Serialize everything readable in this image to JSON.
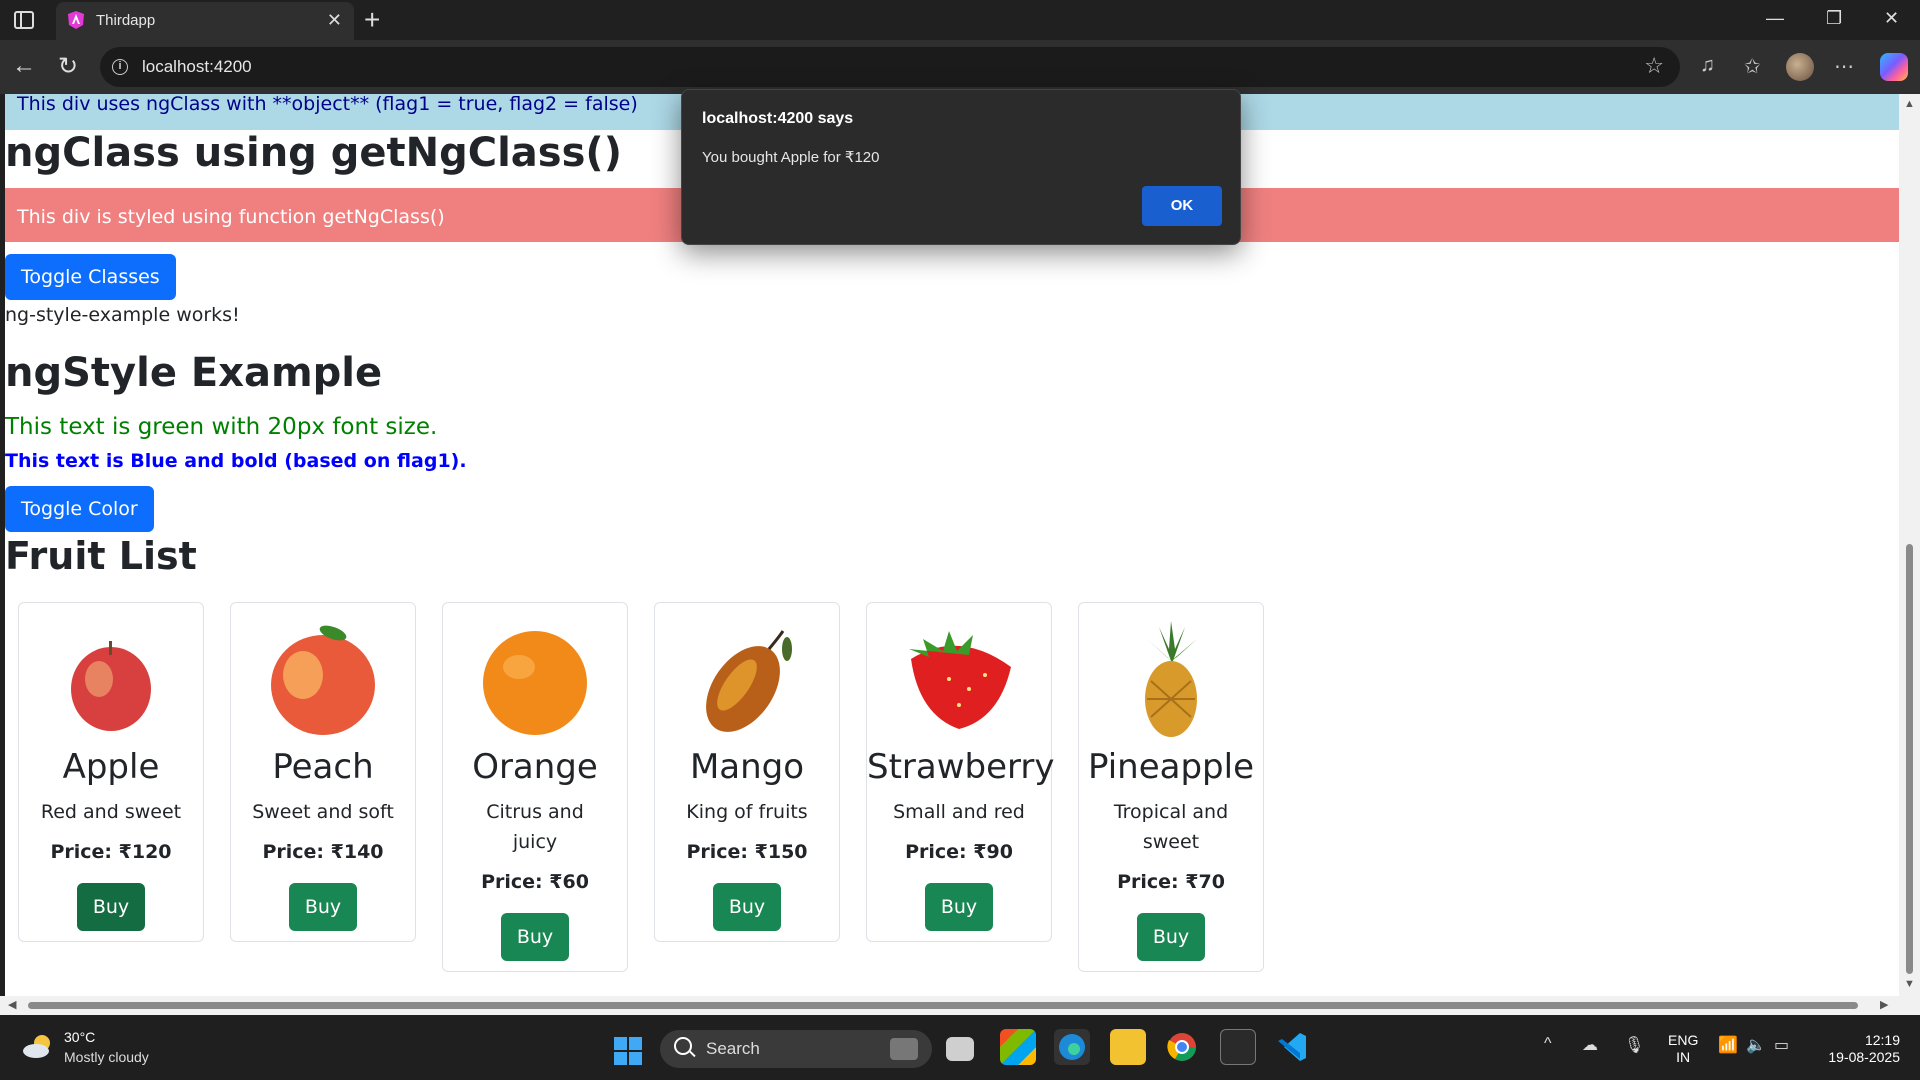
{
  "browser": {
    "tab_title": "Thirdapp",
    "url": "localhost:4200"
  },
  "page": {
    "object_div_text": "This div uses ngClass with **object** (flag1 = true, flag2 = false)",
    "ngclass_heading": "ngClass using getNgClass()",
    "function_div_text": "This div is styled using function getNgClass()",
    "toggle_classes_label": "Toggle Classes",
    "ngstyle_works_text": "ng-style-example works!",
    "ngstyle_heading": "ngStyle Example",
    "green_text": "This text is green with 20px font size.",
    "blue_text": "This text is Blue and bold (based on flag1).",
    "toggle_color_label": "Toggle Color",
    "fruit_heading": "Fruit List",
    "fruits": [
      {
        "name": "Apple",
        "desc": "Red and sweet",
        "price": "Price: ₹120",
        "buy": "Buy"
      },
      {
        "name": "Peach",
        "desc": "Sweet and soft",
        "price": "Price: ₹140",
        "buy": "Buy"
      },
      {
        "name": "Orange",
        "desc": "Citrus and juicy",
        "price": "Price: ₹60",
        "buy": "Buy"
      },
      {
        "name": "Mango",
        "desc": "King of fruits",
        "price": "Price: ₹150",
        "buy": "Buy"
      },
      {
        "name": "Strawberry",
        "desc": "Small and red",
        "price": "Price: ₹90",
        "buy": "Buy"
      },
      {
        "name": "Pineapple",
        "desc": "Tropical and sweet",
        "price": "Price: ₹70",
        "buy": "Buy"
      }
    ]
  },
  "dialog": {
    "title": "localhost:4200 says",
    "message": "You bought Apple for ₹120",
    "ok_label": "OK"
  },
  "taskbar": {
    "temperature": "30°C",
    "weather": "Mostly cloudy",
    "search_label": "Search",
    "lang_line1": "ENG",
    "lang_line2": "IN",
    "time": "12:19",
    "date": "19-08-2025"
  },
  "colors": {
    "primary": "#0d6efd",
    "success": "#198754",
    "light_blue": "#add8e6",
    "light_coral": "#f08080"
  }
}
